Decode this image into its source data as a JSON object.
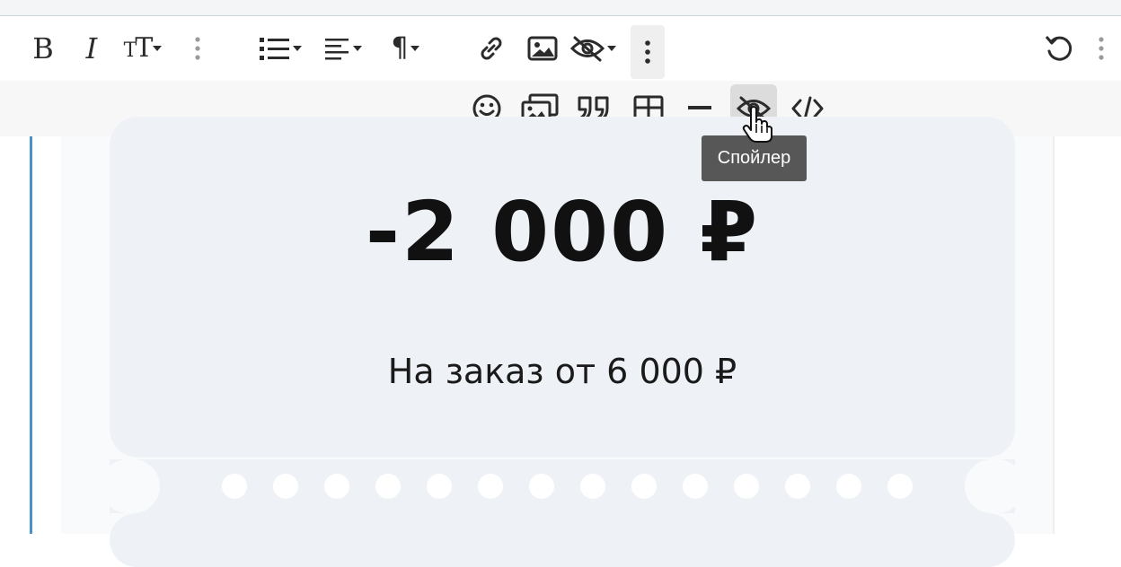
{
  "editor": {
    "main_toolbar": {
      "items": [
        {
          "name": "bold",
          "icon": "bold-icon"
        },
        {
          "name": "italic",
          "icon": "italic-icon"
        },
        {
          "name": "text-size",
          "icon": "text-size-icon"
        },
        {
          "name": "list",
          "icon": "bullet-list-icon"
        },
        {
          "name": "align",
          "icon": "align-left-icon"
        },
        {
          "name": "paragraph",
          "icon": "pilcrow-icon"
        },
        {
          "name": "link",
          "icon": "link-icon"
        },
        {
          "name": "image",
          "icon": "image-icon"
        },
        {
          "name": "hide",
          "icon": "eye-slash-icon"
        },
        {
          "name": "more",
          "icon": "more-vertical-icon"
        },
        {
          "name": "undo",
          "icon": "undo-icon"
        }
      ],
      "glyphs": {
        "bold": "B",
        "italic": "I",
        "text_size_big": "T",
        "text_size_small": "T",
        "paragraph": "¶"
      }
    },
    "sub_toolbar": {
      "items": [
        {
          "name": "emoji",
          "icon": "smiley-icon"
        },
        {
          "name": "gallery",
          "icon": "gallery-icon"
        },
        {
          "name": "quote",
          "icon": "quote-icon"
        },
        {
          "name": "table",
          "icon": "table-icon"
        },
        {
          "name": "horizontal-rule",
          "icon": "minus-icon"
        },
        {
          "name": "spoiler",
          "icon": "eye-slash-icon"
        },
        {
          "name": "code",
          "icon": "code-icon"
        }
      ]
    },
    "tooltip": {
      "text": "Спойлер"
    },
    "colors": {
      "quote_bar": "#4a90c8",
      "tooltip_bg": "#575757",
      "coupon_bg": "#eef2f7"
    }
  },
  "coupon": {
    "amount": "-2 000 ₽",
    "condition": "На заказ от 6 000 ₽"
  }
}
